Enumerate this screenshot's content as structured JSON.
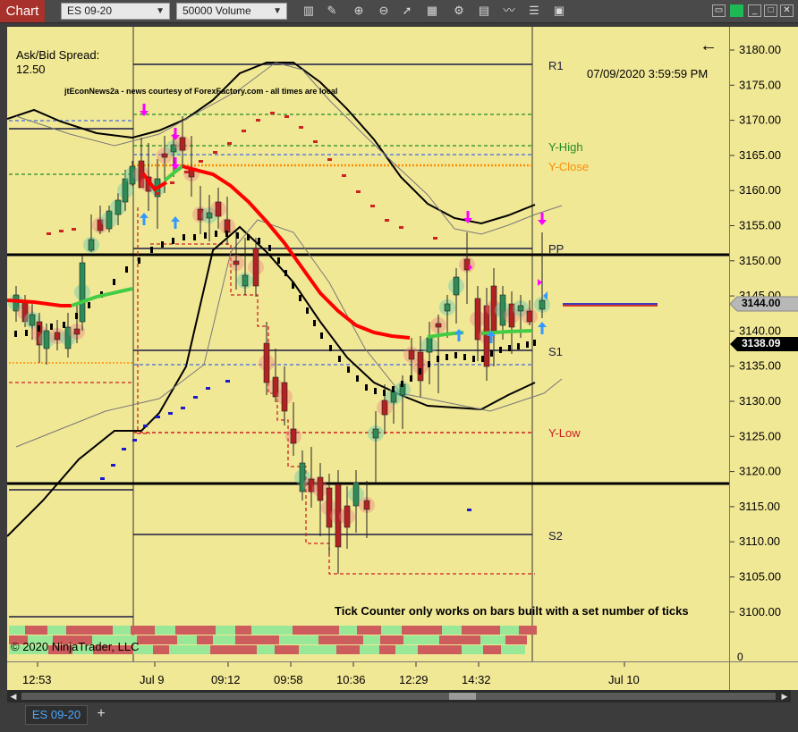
{
  "toolbar": {
    "chart_tab": "Chart",
    "instrument": "ES 09-20",
    "bar_type": "50000 Volume",
    "icons": [
      "bar-type-icon",
      "drawing-tool-icon",
      "zoom-in-icon",
      "zoom-out-icon",
      "pointer-icon",
      "data-box-icon",
      "indicators-icon",
      "strategies-icon",
      "chart-properties-icon"
    ],
    "window_buttons": [
      "minimize-icon",
      "always-on-top-icon",
      "maximize-icon",
      "close-icon"
    ]
  },
  "chart": {
    "spread_label": "Ask/Bid Spread:",
    "spread_value": "12.50",
    "news_text": "jtEconNews2a - news courtesy of ForexFactory.com - all times are local",
    "timestamp": "07/09/2020 3:59:59 PM",
    "back_arrow": "←",
    "tick_counter_msg": "Tick Counter only works on bars built with a set number of ticks",
    "copyright": "© 2020 NinjaTrader, LLC",
    "levels": {
      "r1": "R1",
      "y_high": "Y-High",
      "y_close": "Y-Close",
      "pp": "PP",
      "s1": "S1",
      "y_low": "Y-Low",
      "s2": "S2"
    },
    "colors": {
      "background": "#f1e896",
      "up_candle": "#2e8b57",
      "down_candle": "#b22222",
      "ema": "#ff0000",
      "ema_up": "#44cc44",
      "y_high": "#228b22",
      "y_close": "#ff8c00",
      "y_low": "#cc2222",
      "pivot": "#1a1a40"
    }
  },
  "price_axis": {
    "ticks": [
      "3180.00",
      "3175.00",
      "3170.00",
      "3165.00",
      "3160.00",
      "3155.00",
      "3150.00",
      "3145.00",
      "3140.00",
      "3135.00",
      "3130.00",
      "3125.00",
      "3120.00",
      "3115.00",
      "3110.00",
      "3105.00",
      "3100.00"
    ],
    "current_price": "3144.00",
    "last_price": "3138.09",
    "volume_zero": "0"
  },
  "time_axis": {
    "labels": [
      "12:53",
      "Jul 9",
      "09:12",
      "09:58",
      "10:36",
      "12:29",
      "14:32",
      "Jul 10"
    ]
  },
  "tabs": {
    "active": "ES 09-20",
    "add": "+"
  },
  "chart_data": {
    "type": "candlestick",
    "instrument": "ES 09-20",
    "bar_type": "50000 Volume",
    "levels": {
      "R1": 3177.5,
      "Y-High": 3166.0,
      "Y-Close": 3163.75,
      "PP": 3151.75,
      "S1": 3137.75,
      "Y-Low": 3125.75,
      "S2": 3111.0
    },
    "horizontal_lines": [
      3150.75,
      3118.25
    ],
    "price_range": [
      3098,
      3183
    ],
    "current_price": 3144.0,
    "last_price": 3138.09
  }
}
